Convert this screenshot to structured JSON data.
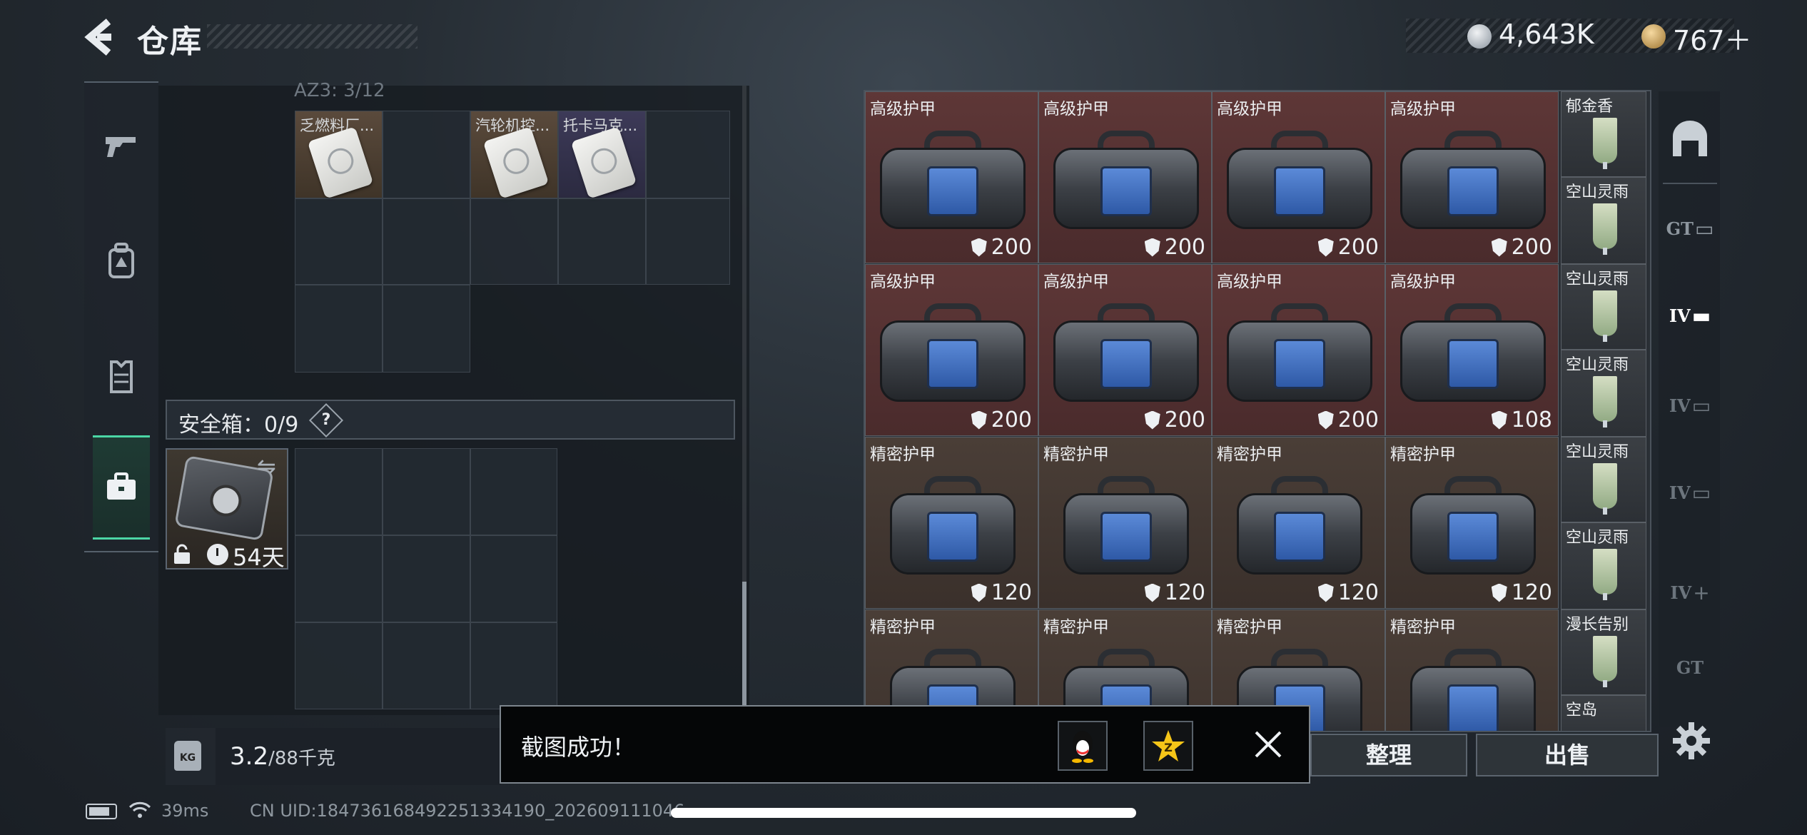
{
  "header": {
    "title": "仓库",
    "currency": [
      {
        "name": "coin",
        "value": "4,643K"
      },
      {
        "name": "bond",
        "value": "767＋"
      }
    ]
  },
  "left_sidebar": {
    "items": [
      "pistol-icon",
      "backpack-icon",
      "vest-icon",
      "briefcase-icon"
    ],
    "active_index": 3
  },
  "container": {
    "label": "AZ3: 3/12",
    "items": [
      {
        "name": "乏燃料厂...",
        "color": "brown"
      },
      {
        "name": "汽轮机控...",
        "color": "brown"
      },
      {
        "name": "托卡马克...",
        "color": "purple"
      }
    ]
  },
  "safebox": {
    "label": "安全箱：0/9",
    "help": "?",
    "days": "54天"
  },
  "weight": {
    "value": "3.2",
    "unit": "/88千克",
    "icon_text": "KG"
  },
  "inventory": {
    "armor": [
      {
        "name": "高级护甲",
        "durability": "200",
        "color": "red"
      },
      {
        "name": "高级护甲",
        "durability": "200",
        "color": "red"
      },
      {
        "name": "高级护甲",
        "durability": "200",
        "color": "red"
      },
      {
        "name": "高级护甲",
        "durability": "200",
        "color": "red"
      },
      {
        "name": "高级护甲",
        "durability": "200",
        "color": "red"
      },
      {
        "name": "高级护甲",
        "durability": "200",
        "color": "red"
      },
      {
        "name": "高级护甲",
        "durability": "200",
        "color": "red"
      },
      {
        "name": "高级护甲",
        "durability": "108",
        "color": "red"
      },
      {
        "name": "精密护甲",
        "durability": "120",
        "color": "brown"
      },
      {
        "name": "精密护甲",
        "durability": "120",
        "color": "brown"
      },
      {
        "name": "精密护甲",
        "durability": "120",
        "color": "brown"
      },
      {
        "name": "精密护甲",
        "durability": "120",
        "color": "brown"
      },
      {
        "name": "精密护甲",
        "durability": "",
        "color": "brown"
      },
      {
        "name": "精密护甲",
        "durability": "",
        "color": "brown"
      },
      {
        "name": "精密护甲",
        "durability": "",
        "color": "brown"
      },
      {
        "name": "精密护甲",
        "durability": "",
        "color": "brown"
      }
    ],
    "drinks": [
      "郁金香",
      "空山灵雨",
      "空山灵雨",
      "空山灵雨",
      "空山灵雨",
      "空山灵雨",
      "漫长告别",
      "空岛"
    ]
  },
  "right_sidebar": {
    "items": [
      "home-icon",
      "GT-tab",
      "IV-tab",
      "IV-tab",
      "IV-tab",
      "IV-add-tab",
      "GT-tab"
    ],
    "labels": [
      "GT",
      "IV",
      "IV",
      "IV",
      "IV",
      "GT"
    ]
  },
  "actions": {
    "sort": "整理",
    "sell": "出售"
  },
  "toast": {
    "message": "截图成功！"
  },
  "status": {
    "ping": "39ms",
    "uid": "CN UID:184736168492251334190_202609111046"
  },
  "colors": {
    "accent": "#4bd6a5",
    "red_rarity": "#5e3737",
    "brown_rarity": "#4a3e37",
    "armor_plate": "#5b8ad8"
  }
}
